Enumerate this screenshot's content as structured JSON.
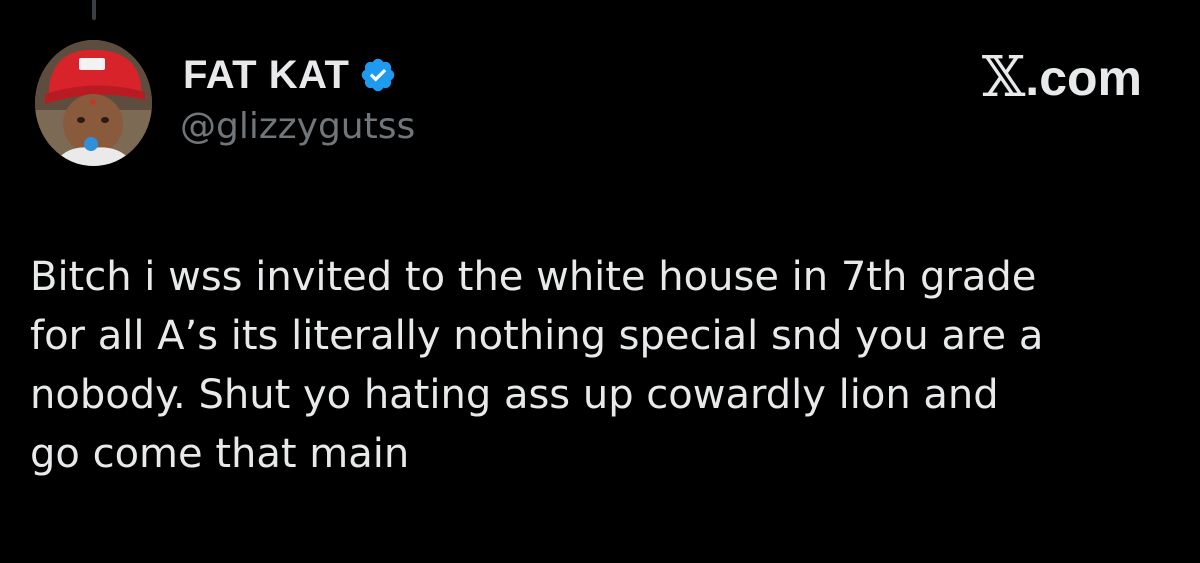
{
  "tweet": {
    "author": {
      "display_name": "FAT KAT",
      "handle": "@glizzygutss",
      "verified": true,
      "avatar_icon": "profile-photo-avatar",
      "badge_icon": "verified-checkmark-icon",
      "badge_color": "#1d9bf0"
    },
    "text_lines": [
      "Bitch i wss invited to the white house in 7th grade",
      "for all A’s its literally nothing special snd you are a",
      "nobody. Shut yo hating ass up cowardly lion and",
      "go come that main"
    ]
  },
  "site": {
    "x_logo": "𝕏",
    "domain": ".com"
  },
  "colors": {
    "background": "#000000",
    "primary_text": "#e7e9ea",
    "secondary_text": "#71767b",
    "thread_line": "#3b3f43"
  }
}
